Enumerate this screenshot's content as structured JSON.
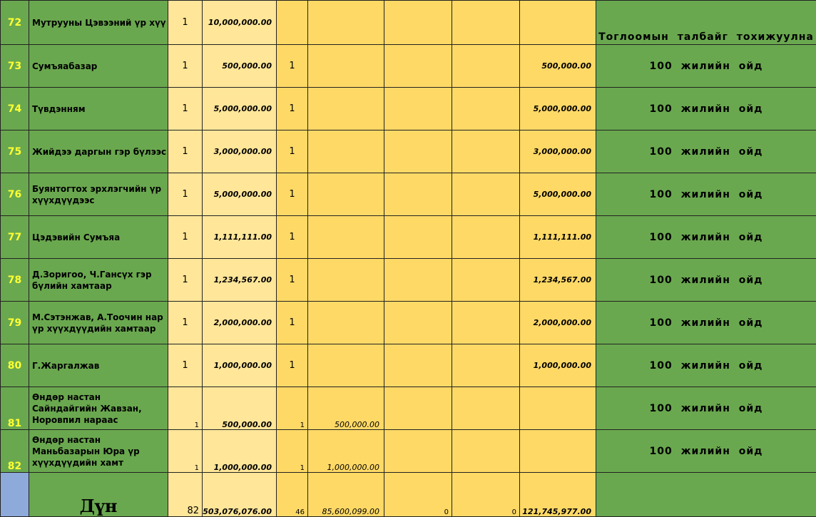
{
  "rows": [
    {
      "num": "72",
      "name": "Мутрууны Цэвээний үр хүү",
      "qty": "1",
      "amount": "10,000,000.00",
      "count2": "",
      "amount2": "",
      "c7": "",
      "c8": "",
      "amount3": "",
      "note": "Тоглоомын талбайг тохижуулна"
    },
    {
      "num": "73",
      "name": "Сумъяабазар",
      "qty": "1",
      "amount": "500,000.00",
      "count2": "1",
      "amount2": "",
      "c7": "",
      "c8": "",
      "amount3": "500,000.00",
      "note": "100 жилийн ойд"
    },
    {
      "num": "74",
      "name": "Түвдэнням",
      "qty": "1",
      "amount": "5,000,000.00",
      "count2": "1",
      "amount2": "",
      "c7": "",
      "c8": "",
      "amount3": "5,000,000.00",
      "note": "100 жилийн ойд"
    },
    {
      "num": "75",
      "name": "Жийдээ даргын гэр бүлээс",
      "qty": "1",
      "amount": "3,000,000.00",
      "count2": "1",
      "amount2": "",
      "c7": "",
      "c8": "",
      "amount3": "3,000,000.00",
      "note": "100 жилийн ойд"
    },
    {
      "num": "76",
      "name": "Буянтогтох эрхлэгчийн үр хүүхдүүдээс",
      "qty": "1",
      "amount": "5,000,000.00",
      "count2": "1",
      "amount2": "",
      "c7": "",
      "c8": "",
      "amount3": "5,000,000.00",
      "note": "100 жилийн ойд"
    },
    {
      "num": "77",
      "name": "Цэдэвийн Сумъяа",
      "qty": "1",
      "amount": "1,111,111.00",
      "count2": "1",
      "amount2": "",
      "c7": "",
      "c8": "",
      "amount3": "1,111,111.00",
      "note": "100 жилийн ойд"
    },
    {
      "num": "78",
      "name": "Д.Зоригоо, Ч.Гансүх гэр бүлийн хамтаар",
      "qty": "1",
      "amount": "1,234,567.00",
      "count2": "1",
      "amount2": "",
      "c7": "",
      "c8": "",
      "amount3": "1,234,567.00",
      "note": "100 жилийн ойд"
    },
    {
      "num": "79",
      "name": "М.Сэтэнжав, А.Тоочин нар үр хүүхдүүдийн хамтаар",
      "qty": "1",
      "amount": "2,000,000.00",
      "count2": "1",
      "amount2": "",
      "c7": "",
      "c8": "",
      "amount3": "2,000,000.00",
      "note": "100 жилийн ойд"
    },
    {
      "num": "80",
      "name": "Г.Жаргалжав",
      "qty": "1",
      "amount": "1,000,000.00",
      "count2": "1",
      "amount2": "",
      "c7": "",
      "c8": "",
      "amount3": "1,000,000.00",
      "note": "100 жилийн ойд"
    },
    {
      "num": "81",
      "name": "Өндөр настан Сайндайгийн Жавзан, Норовпил нараас",
      "qty": "1",
      "amount": "500,000.00",
      "count2": "1",
      "amount2": "500,000.00",
      "c7": "",
      "c8": "",
      "amount3": "",
      "note": "100 жилийн ойд"
    },
    {
      "num": "82",
      "name": "Өндөр настан Маньбазарын Юра үр хүүхдүүдийн хамт",
      "qty": "1",
      "amount": "1,000,000.00",
      "count2": "1",
      "amount2": "1,000,000.00",
      "c7": "",
      "c8": "",
      "amount3": "",
      "note": "100 жилийн ойд"
    }
  ],
  "total": {
    "label": "Дүн",
    "qty": "82",
    "amount": "503,076,076.00",
    "count2": "46",
    "amount2": "85,600,099.00",
    "c7": "0",
    "c8": "0",
    "amount3": "121,745,977.00"
  }
}
